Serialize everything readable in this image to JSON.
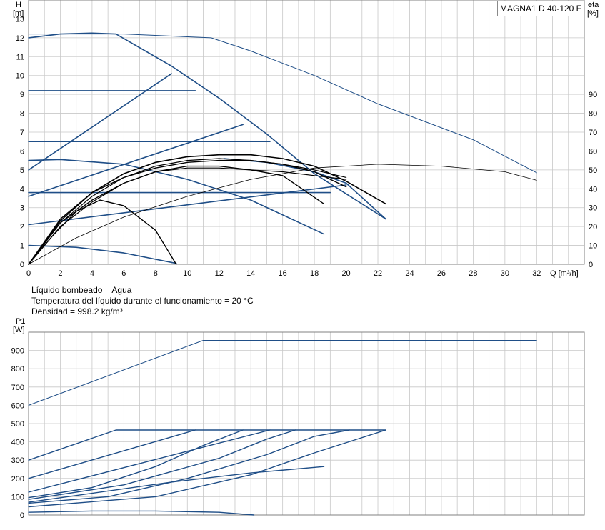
{
  "model": "MAGNA1 D 40-120 F",
  "notes": {
    "liquid": "Líquido bombeado = Agua",
    "temperature": "Temperatura del líquido durante el funcionamiento = 20 °C",
    "density": "Densidad = 998.2 kg/m³"
  },
  "colors": {
    "blue": "#1f4e87",
    "black": "#000000",
    "grid": "#c8c8c8"
  },
  "chart_data": [
    {
      "type": "line",
      "title": "",
      "xlabel": "Q [m³/h]",
      "ylabel_line1": "H",
      "ylabel_line2": "[m]",
      "y2label_line1": "eta",
      "y2label_line2": "[%]",
      "xlim": [
        0,
        35
      ],
      "ylim": [
        0,
        14
      ],
      "y2lim": [
        0,
        140
      ],
      "grid": true,
      "x_ticks": [
        "0",
        "2",
        "4",
        "6",
        "8",
        "10",
        "12",
        "14",
        "16",
        "18",
        "20",
        "22",
        "24",
        "26",
        "28",
        "30",
        "32"
      ],
      "y_ticks": [
        "0",
        "1",
        "2",
        "3",
        "4",
        "5",
        "6",
        "7",
        "8",
        "9",
        "10",
        "11",
        "12",
        "13"
      ],
      "y2_ticks": [
        "0",
        "10",
        "20",
        "30",
        "40",
        "50",
        "60",
        "70",
        "80",
        "90"
      ],
      "series": [
        {
          "axis": "left",
          "color": "blue",
          "width": 1.6,
          "points": [
            [
              0,
              12
            ],
            [
              2,
              12.2
            ],
            [
              4,
              12.25
            ],
            [
              5.5,
              12.2
            ]
          ]
        },
        {
          "axis": "left",
          "color": "blue",
          "width": 1.6,
          "points": [
            [
              5.5,
              12.2
            ],
            [
              9,
              10.5
            ],
            [
              12,
              8.8
            ],
            [
              15,
              6.9
            ],
            [
              18,
              4.8
            ],
            [
              22.5,
              2.4
            ]
          ]
        },
        {
          "axis": "left",
          "color": "blue",
          "width": 1.6,
          "points": [
            [
              0,
              9.2
            ],
            [
              10.5,
              9.2
            ]
          ]
        },
        {
          "axis": "left",
          "color": "blue",
          "width": 1.6,
          "points": [
            [
              0,
              6.5
            ],
            [
              15.2,
              6.5
            ]
          ]
        },
        {
          "axis": "left",
          "color": "blue",
          "width": 1.6,
          "points": [
            [
              0,
              3.8
            ],
            [
              19,
              3.8
            ]
          ]
        },
        {
          "axis": "left",
          "color": "blue",
          "width": 1.6,
          "points": [
            [
              0,
              5
            ],
            [
              9,
              10.1
            ]
          ]
        },
        {
          "axis": "left",
          "color": "blue",
          "width": 1.6,
          "points": [
            [
              0,
              3.6
            ],
            [
              13.5,
              7.4
            ]
          ]
        },
        {
          "axis": "left",
          "color": "blue",
          "width": 1.6,
          "points": [
            [
              0,
              2.1
            ],
            [
              20,
              4.2
            ]
          ]
        },
        {
          "axis": "left",
          "color": "blue",
          "width": 1.6,
          "points": [
            [
              0,
              5.5
            ],
            [
              2,
              5.55
            ],
            [
              6,
              5.3
            ],
            [
              10,
              4.5
            ],
            [
              14,
              3.4
            ],
            [
              18.6,
              1.6
            ]
          ]
        },
        {
          "axis": "left",
          "color": "blue",
          "width": 1.6,
          "points": [
            [
              0,
              1
            ],
            [
              3,
              0.9
            ],
            [
              6,
              0.6
            ],
            [
              9.3,
              0.05
            ]
          ]
        },
        {
          "axis": "left",
          "color": "blue",
          "width": 1.6,
          "points": [
            [
              12.3,
              5.6
            ],
            [
              15,
              5.4
            ],
            [
              18,
              4.9
            ],
            [
              20,
              4.3
            ],
            [
              22.5,
              2.4
            ]
          ]
        },
        {
          "axis": "left",
          "color": "blue",
          "width": 1,
          "points": [
            [
              0,
              12.2
            ],
            [
              6,
              12.2
            ],
            [
              11.5,
              12.0
            ],
            [
              14,
              11.3
            ],
            [
              18,
              10.0
            ],
            [
              22,
              8.5
            ],
            [
              28,
              6.6
            ],
            [
              32,
              4.85
            ]
          ]
        },
        {
          "axis": "right",
          "color": "black",
          "width": 0.8,
          "points": [
            [
              0,
              0
            ],
            [
              3,
              14
            ],
            [
              6,
              25
            ],
            [
              10,
              36
            ],
            [
              14,
              45
            ],
            [
              18,
              51
            ],
            [
              22,
              53
            ],
            [
              26,
              52
            ],
            [
              30,
              49
            ],
            [
              32,
              44.5
            ]
          ]
        },
        {
          "axis": "right",
          "color": "black",
          "width": 1.4,
          "points": [
            [
              0,
              0
            ],
            [
              2,
              22
            ],
            [
              4,
              34
            ],
            [
              6,
              43
            ],
            [
              8,
              49
            ],
            [
              10,
              52
            ],
            [
              12,
              52
            ],
            [
              14,
              50
            ],
            [
              16,
              47
            ],
            [
              18.6,
              32
            ]
          ]
        },
        {
          "axis": "right",
          "color": "black",
          "width": 1.4,
          "points": [
            [
              0,
              0
            ],
            [
              2,
              24
            ],
            [
              4,
              38
            ],
            [
              6,
              46
            ],
            [
              8,
              51
            ],
            [
              10,
              54
            ],
            [
              12,
              55
            ],
            [
              14,
              55
            ],
            [
              16,
              53
            ],
            [
              18,
              49
            ],
            [
              20,
              41
            ]
          ]
        },
        {
          "axis": "right",
          "color": "black",
          "width": 1.6,
          "points": [
            [
              0,
              0
            ],
            [
              2,
              23
            ],
            [
              4,
              38
            ],
            [
              6,
              48
            ],
            [
              8,
              54
            ],
            [
              10,
              57
            ],
            [
              12,
              58
            ],
            [
              14,
              58
            ],
            [
              16,
              56
            ],
            [
              18,
              52
            ],
            [
              20,
              44
            ],
            [
              22.5,
              32
            ]
          ]
        },
        {
          "axis": "right",
          "color": "black",
          "width": 1.2,
          "points": [
            [
              0,
              0
            ],
            [
              2,
              22
            ],
            [
              4,
              36
            ],
            [
              6,
              46
            ],
            [
              8,
              52
            ],
            [
              10,
              55
            ],
            [
              12,
              56
            ],
            [
              14,
              55
            ],
            [
              16,
              53
            ],
            [
              18,
              50
            ],
            [
              20,
              46
            ]
          ]
        },
        {
          "axis": "right",
          "color": "black",
          "width": 1.2,
          "points": [
            [
              0,
              0
            ],
            [
              2,
              20
            ],
            [
              4,
              33
            ],
            [
              6,
              43
            ],
            [
              8,
              49
            ],
            [
              10,
              51
            ],
            [
              12,
              51
            ],
            [
              14,
              50
            ],
            [
              16,
              49
            ],
            [
              18,
              47
            ],
            [
              20,
              45
            ]
          ]
        },
        {
          "axis": "right",
          "color": "black",
          "width": 1.4,
          "points": [
            [
              0,
              0
            ],
            [
              1.5,
              15
            ],
            [
              3,
              28
            ],
            [
              4.5,
              34
            ],
            [
              6,
              31
            ],
            [
              8,
              18
            ],
            [
              9.3,
              0
            ]
          ]
        }
      ]
    },
    {
      "type": "line",
      "title": "",
      "xlabel": "",
      "ylabel_line1": "P1",
      "ylabel_line2": "[W]",
      "xlim": [
        0,
        35
      ],
      "ylim": [
        0,
        1000
      ],
      "grid": true,
      "y_ticks": [
        "0",
        "100",
        "200",
        "300",
        "400",
        "500",
        "600",
        "700",
        "800",
        "900"
      ],
      "series": [
        {
          "color": "blue",
          "width": 1,
          "points": [
            [
              0,
              600
            ],
            [
              11,
              955
            ],
            [
              32,
              955
            ]
          ]
        },
        {
          "color": "blue",
          "width": 1.4,
          "points": [
            [
              0,
              300
            ],
            [
              5.5,
              465
            ],
            [
              22.5,
              465
            ]
          ]
        },
        {
          "color": "blue",
          "width": 1.4,
          "points": [
            [
              0,
              200
            ],
            [
              10.5,
              465
            ]
          ]
        },
        {
          "color": "blue",
          "width": 1.4,
          "points": [
            [
              0,
              125
            ],
            [
              15.2,
              465
            ]
          ]
        },
        {
          "color": "blue",
          "width": 1.4,
          "points": [
            [
              0,
              95
            ],
            [
              4,
              150
            ],
            [
              8,
              265
            ],
            [
              11,
              380
            ],
            [
              13.5,
              465
            ]
          ]
        },
        {
          "color": "blue",
          "width": 1.4,
          "points": [
            [
              0,
              85
            ],
            [
              6,
              165
            ],
            [
              12,
              310
            ],
            [
              15,
              415
            ],
            [
              16.8,
              465
            ]
          ]
        },
        {
          "color": "blue",
          "width": 1.4,
          "points": [
            [
              0,
              65
            ],
            [
              5,
              100
            ],
            [
              10,
              200
            ],
            [
              15,
              330
            ],
            [
              18,
              430
            ],
            [
              20.2,
              465
            ]
          ]
        },
        {
          "color": "blue",
          "width": 1.4,
          "points": [
            [
              0,
              45
            ],
            [
              8,
              100
            ],
            [
              14,
              220
            ],
            [
              18,
              340
            ],
            [
              22.5,
              465
            ]
          ]
        },
        {
          "color": "blue",
          "width": 1.4,
          "points": [
            [
              0,
              70
            ],
            [
              9,
              180
            ],
            [
              14,
              230
            ],
            [
              18.6,
              265
            ]
          ]
        },
        {
          "color": "blue",
          "width": 1.4,
          "points": [
            [
              0,
              15
            ],
            [
              4,
              22
            ],
            [
              8,
              22
            ],
            [
              12,
              15
            ],
            [
              14.2,
              0
            ]
          ]
        }
      ]
    }
  ]
}
